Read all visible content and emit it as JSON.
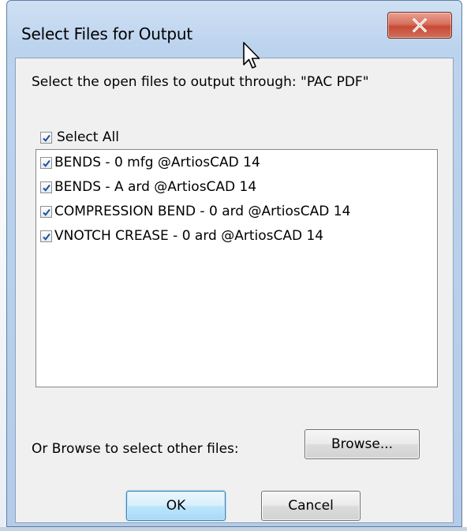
{
  "window": {
    "title": "Select Files for Output",
    "close_icon": "close-x-icon"
  },
  "dialog": {
    "instruction": "Select the open files to output through: \"PAC PDF\"",
    "select_all": {
      "label": "Select All",
      "checked": true
    },
    "files": [
      {
        "label": "BENDS - 0 mfg @ArtiosCAD 14",
        "checked": true
      },
      {
        "label": "BENDS - A ard @ArtiosCAD 14",
        "checked": true
      },
      {
        "label": "COMPRESSION BEND - 0 ard @ArtiosCAD 14",
        "checked": true
      },
      {
        "label": "VNOTCH CREASE - 0 ard @ArtiosCAD 14",
        "checked": true
      }
    ],
    "browse_prompt": "Or Browse to select other files:",
    "browse_button": "Browse...",
    "ok_button": "OK",
    "cancel_button": "Cancel"
  },
  "colors": {
    "title_bar": "#bcd3ee",
    "close_button": "#c74a35",
    "check_mark": "#1e4f9c",
    "client_bg": "#f0f0f0"
  }
}
